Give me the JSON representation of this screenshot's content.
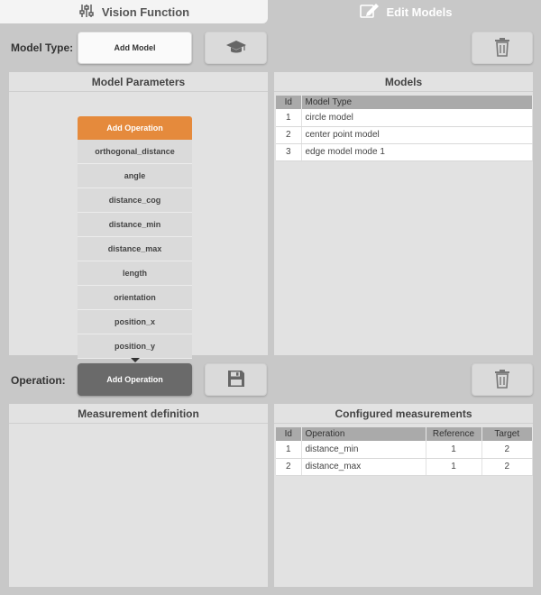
{
  "tabs": {
    "vision_function": "Vision Function",
    "edit_models": "Edit Models"
  },
  "model_row": {
    "label": "Model Type:",
    "add_model": "Add Model"
  },
  "operation_row": {
    "label": "Operation:",
    "add_operation": "Add Operation"
  },
  "model_parameters": {
    "title": "Model Parameters",
    "dropdown_header": "Add Operation",
    "options": [
      "orthogonal_distance",
      "angle",
      "distance_cog",
      "distance_min",
      "distance_max",
      "length",
      "orientation",
      "position_x",
      "position_y"
    ]
  },
  "models": {
    "title": "Models",
    "columns": [
      "Id",
      "Model Type"
    ],
    "rows": [
      {
        "id": "1",
        "type": "circle model"
      },
      {
        "id": "2",
        "type": "center point model"
      },
      {
        "id": "3",
        "type": "edge model mode 1"
      }
    ]
  },
  "measurement_definition": {
    "title": "Measurement definition"
  },
  "configured_measurements": {
    "title": "Configured measurements",
    "columns": [
      "Id",
      "Operation",
      "Reference",
      "Target"
    ],
    "rows": [
      {
        "id": "1",
        "operation": "distance_min",
        "reference": "1",
        "target": "2"
      },
      {
        "id": "2",
        "operation": "distance_max",
        "reference": "1",
        "target": "2"
      }
    ]
  },
  "icons": {
    "vision": "sliders-icon",
    "edit": "edit-icon",
    "teach": "graduation-cap-icon",
    "delete": "trash-icon",
    "save": "floppy-disk-icon"
  },
  "colors": {
    "accent": "#e58a3c",
    "background": "#c8c8c8",
    "panel": "#e2e2e2",
    "table_header": "#aaaaaa"
  }
}
